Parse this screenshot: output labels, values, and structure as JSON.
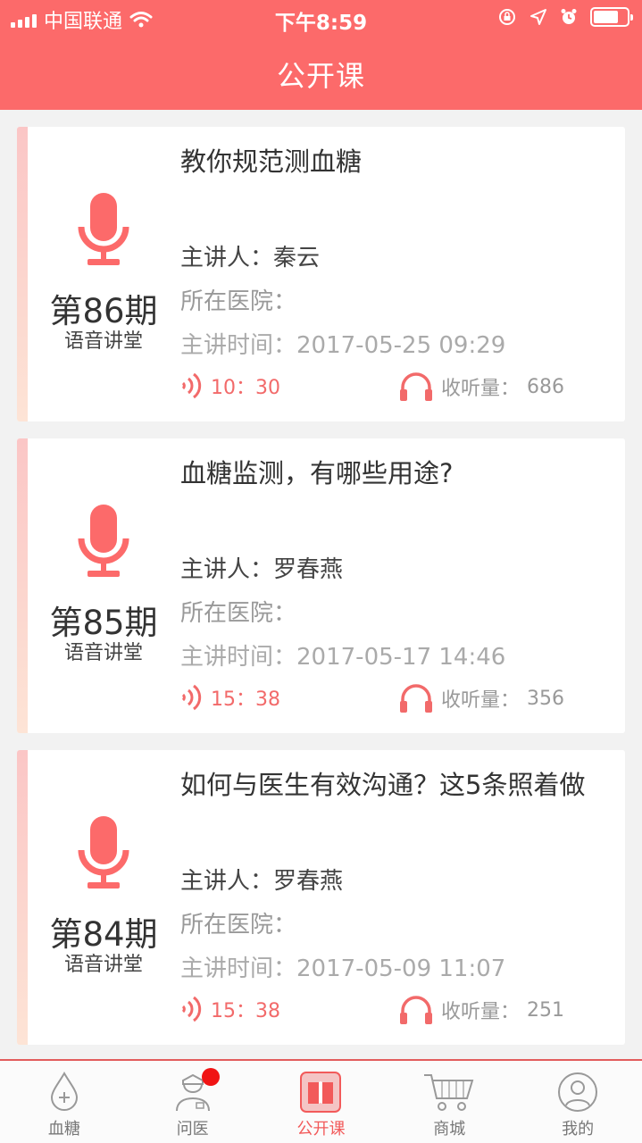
{
  "status_bar": {
    "carrier": "中国联通",
    "time": "下午8:59"
  },
  "header": {
    "title": "公开课"
  },
  "colors": {
    "accent": "#fc6a6a",
    "card_bg": "#ffffff",
    "page_bg": "#f2f2f2"
  },
  "lectures": [
    {
      "period": "第86期",
      "type": "语音讲堂",
      "title": "教你规范测血糖",
      "speaker_label": "主讲人：",
      "speaker": "秦云",
      "hospital_label": "所在医院：",
      "hospital": "",
      "time_label": "主讲时间：",
      "time": "2017-05-25 09:29",
      "duration": "10：30",
      "listens_label": "收听量：",
      "listens": "686"
    },
    {
      "period": "第85期",
      "type": "语音讲堂",
      "title": "血糖监测，有哪些用途?",
      "speaker_label": "主讲人：",
      "speaker": "罗春燕",
      "hospital_label": "所在医院：",
      "hospital": "",
      "time_label": "主讲时间：",
      "time": "2017-05-17 14:46",
      "duration": "15：38",
      "listens_label": "收听量：",
      "listens": "356"
    },
    {
      "period": "第84期",
      "type": "语音讲堂",
      "title": "如何与医生有效沟通？这5条照着做",
      "speaker_label": "主讲人：",
      "speaker": "罗春燕",
      "hospital_label": "所在医院：",
      "hospital": "",
      "time_label": "主讲时间：",
      "time": "2017-05-09 11:07",
      "duration": "15：38",
      "listens_label": "收听量：",
      "listens": "251"
    }
  ],
  "tabs": [
    {
      "label": "血糖",
      "icon": "blood-drop-icon",
      "active": false
    },
    {
      "label": "问医",
      "icon": "doctor-icon",
      "active": false,
      "badge": true
    },
    {
      "label": "公开课",
      "icon": "book-icon",
      "active": true
    },
    {
      "label": "商城",
      "icon": "cart-icon",
      "active": false
    },
    {
      "label": "我的",
      "icon": "profile-icon",
      "active": false
    }
  ]
}
